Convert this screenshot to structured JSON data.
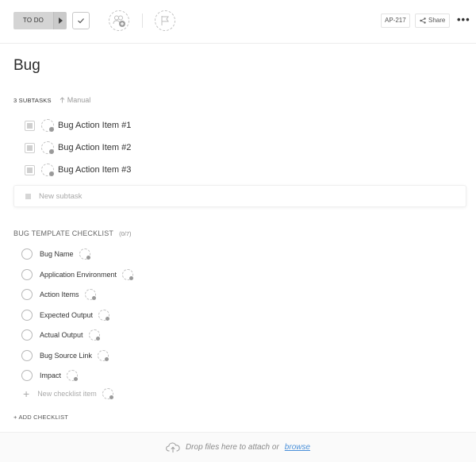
{
  "toolbar": {
    "status_label": "TO DO",
    "task_id": "AP-217",
    "share_label": "Share",
    "more_label": "•••"
  },
  "title": "Bug",
  "subtasks": {
    "count_label": "3 SUBTASKS",
    "sort_label": "Manual",
    "items": [
      {
        "label": "Bug Action Item #1"
      },
      {
        "label": "Bug Action Item #2"
      },
      {
        "label": "Bug Action Item #3"
      }
    ],
    "new_placeholder": "New subtask"
  },
  "checklist": {
    "title": "BUG TEMPLATE CHECKLIST",
    "count": "(0/7)",
    "items": [
      {
        "label": "Bug Name"
      },
      {
        "label": "Application Environment"
      },
      {
        "label": "Action Items"
      },
      {
        "label": "Expected Output"
      },
      {
        "label": "Actual Output"
      },
      {
        "label": "Bug Source Link"
      },
      {
        "label": "Impact"
      }
    ],
    "new_placeholder": "New checklist item",
    "add_label": "+ ADD CHECKLIST"
  },
  "dropzone": {
    "text": "Drop files here to attach or",
    "browse": "browse"
  }
}
